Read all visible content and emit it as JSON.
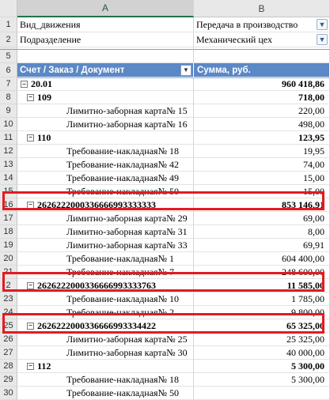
{
  "columns": {
    "row_corner": "",
    "a": "A",
    "b": "B"
  },
  "filters": [
    {
      "row": "1",
      "field": "Вид_движения",
      "value": "Передача в производство"
    },
    {
      "row": "2",
      "field": "Подразделение",
      "value": "Механический цех"
    }
  ],
  "blank_rows": [
    "5"
  ],
  "header_row": {
    "row": "6",
    "col_a": "Счет / Заказ / Документ",
    "col_b": "Сумма, руб."
  },
  "rows": [
    {
      "row": "7",
      "level": 1,
      "toggle": "−",
      "label": "20.01",
      "value": "960 418,86"
    },
    {
      "row": "8",
      "level": 2,
      "toggle": "−",
      "label": "109",
      "value": "718,00"
    },
    {
      "row": "9",
      "level": 3,
      "label": "Лимитно-заборная карта№ 15",
      "value": "220,00"
    },
    {
      "row": "10",
      "level": 3,
      "label": "Лимитно-заборная карта№ 16",
      "value": "498,00"
    },
    {
      "row": "11",
      "level": 2,
      "toggle": "−",
      "label": "110",
      "value": "123,95"
    },
    {
      "row": "12",
      "level": 3,
      "label": "Требование-накладная№ 18",
      "value": "19,95"
    },
    {
      "row": "13",
      "level": 3,
      "label": "Требование-накладная№ 42",
      "value": "74,00"
    },
    {
      "row": "14",
      "level": 3,
      "label": "Требование-накладная№ 49",
      "value": "15,00"
    },
    {
      "row": "15",
      "level": 3,
      "label": "Требование-накладная№ 50",
      "value": "15,00"
    },
    {
      "row": "16",
      "level": 2,
      "toggle": "−",
      "label": "2626222000336666993333333",
      "value": "853 146,91",
      "highlight": true
    },
    {
      "row": "17",
      "level": 3,
      "label": "Лимитно-заборная карта№ 29",
      "value": "69,00"
    },
    {
      "row": "18",
      "level": 3,
      "label": "Лимитно-заборная карта№ 31",
      "value": "8,00"
    },
    {
      "row": "19",
      "level": 3,
      "label": "Лимитно-заборная карта№ 33",
      "value": "69,91"
    },
    {
      "row": "20",
      "level": 3,
      "label": "Требование-накладная№ 1",
      "value": "604 400,00"
    },
    {
      "row": "21",
      "level": 3,
      "label": "Требование-накладная№ 7",
      "value": "248 600,00"
    },
    {
      "row": "2",
      "level": 2,
      "toggle": "−",
      "label": "2626222000336666993333763",
      "value": "11 585,00",
      "highlight": true
    },
    {
      "row": "23",
      "level": 3,
      "label": "Требование-накладная№ 10",
      "value": "1 785,00"
    },
    {
      "row": "24",
      "level": 3,
      "label": "Требование-накладная№ 2",
      "value": "9 800,00"
    },
    {
      "row": "25",
      "level": 2,
      "toggle": "−",
      "label": "2626222000336666993334422",
      "value": "65 325,00",
      "highlight": true
    },
    {
      "row": "26",
      "level": 3,
      "label": "Лимитно-заборная карта№ 25",
      "value": "25 325,00"
    },
    {
      "row": "27",
      "level": 3,
      "label": "Лимитно-заборная карта№ 30",
      "value": "40 000,00"
    },
    {
      "row": "28",
      "level": 2,
      "toggle": "−",
      "label": "112",
      "value": "5 300,00"
    },
    {
      "row": "29",
      "level": 3,
      "label": "Требование-накладная№ 18",
      "value": "5 300,00"
    },
    {
      "row": "30",
      "level": 3,
      "label": "Требование-накладная№ 50",
      "value": ""
    }
  ],
  "colors": {
    "header_fill": "#5b88c6",
    "highlight_border": "#e11b22",
    "selection": "#217346"
  }
}
